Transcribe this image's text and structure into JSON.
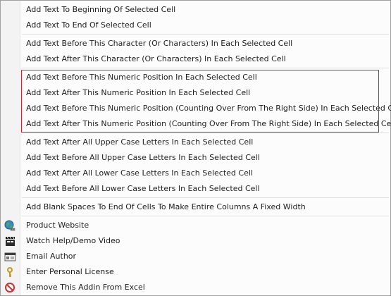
{
  "menu": {
    "items": [
      {
        "label": "Add Text To Beginning Of Selected Cell"
      },
      {
        "label": "Add Text To End Of Selected Cell"
      },
      {
        "label": "Add Text Before This Character (Or Characters) In Each Selected Cell"
      },
      {
        "label": "Add Text After This Character (Or Characters) In Each Selected Cell"
      },
      {
        "label": "Add Text Before This Numeric Position In Each Selected Cell"
      },
      {
        "label": "Add Text After This Numeric Position In Each Selected Cell"
      },
      {
        "label": "Add Text Before This Numeric Position (Counting Over From The Right Side) In Each Selected Cell"
      },
      {
        "label": "Add Text After This Numeric Position (Counting Over From The Right Side) In Each Selected Cell"
      },
      {
        "label": "Add Text After All Upper Case Letters In Each Selected Cell"
      },
      {
        "label": "Add Text Before All Upper Case Letters In Each Selected Cell"
      },
      {
        "label": "Add Text After All Lower Case Letters In Each Selected Cell"
      },
      {
        "label": "Add Text Before All Lower Case Letters In Each Selected Cell"
      },
      {
        "label": "Add Blank Spaces To End Of Cells To Make Entire Columns A Fixed Width"
      },
      {
        "label": "Product Website",
        "icon": "globe-icon"
      },
      {
        "label": "Watch Help/Demo Video",
        "icon": "clapperboard-icon"
      },
      {
        "label": "Email Author",
        "icon": "email-card-icon"
      },
      {
        "label": "Enter Personal License",
        "icon": "key-icon"
      },
      {
        "label": "Remove This Addin From Excel",
        "icon": "prohibited-icon"
      }
    ]
  },
  "colors": {
    "highlight_border": "#d2232a",
    "menu_border": "#a0a0a0",
    "gutter": "#f3f3f3",
    "separator": "#e0e0e0"
  }
}
